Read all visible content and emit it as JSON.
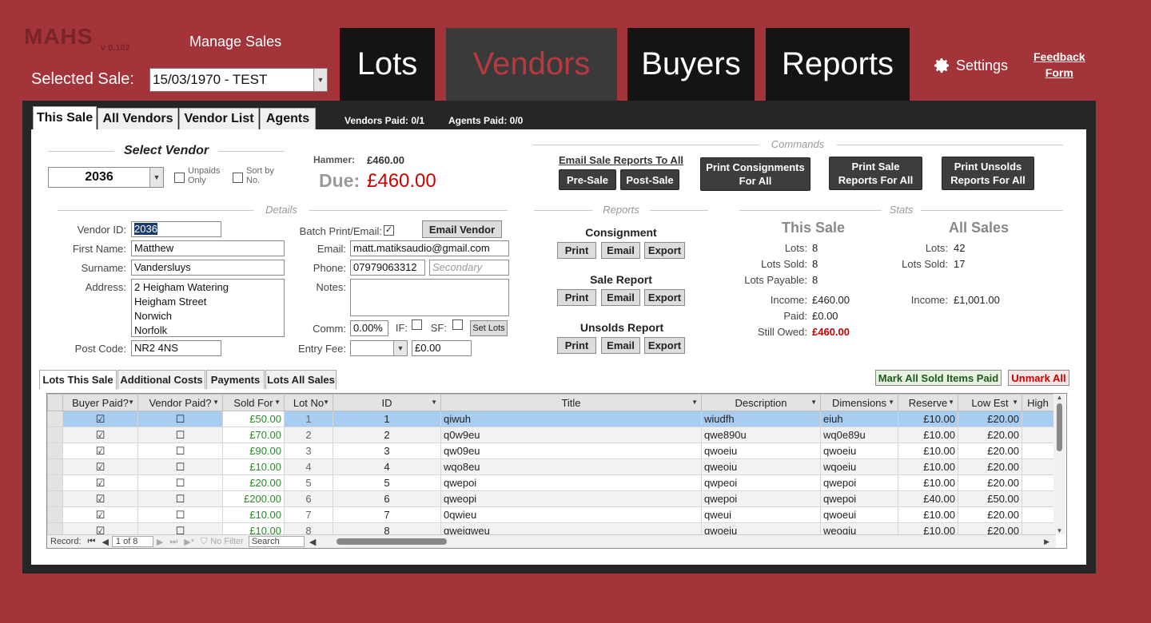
{
  "app": {
    "logo": "MAHS",
    "version": "v 0.102",
    "manage": "Manage Sales",
    "selected_sale_label": "Selected Sale:",
    "selected_sale": "15/03/1970 - TEST",
    "settings": "Settings",
    "feedback_line1": "Feedback",
    "feedback_line2": "Form"
  },
  "nav": {
    "lots": "Lots",
    "vendors": "Vendors",
    "buyers": "Buyers",
    "reports": "Reports"
  },
  "tabs": {
    "this_sale": "This Sale",
    "all_vendors": "All Vendors",
    "vendor_list": "Vendor List",
    "agents": "Agents",
    "vendors_paid": "Vendors Paid: 0/1",
    "agents_paid": "Agents Paid: 0/0"
  },
  "select": {
    "title": "Select Vendor",
    "vendor": "2036",
    "unpaids": "Unpaids Only",
    "sort": "Sort by No.",
    "hammer_label": "Hammer:",
    "hammer": "£460.00",
    "due_label": "Due:",
    "due": "£460.00"
  },
  "commands": {
    "title": "Commands",
    "email_reports": "Email Sale Reports To All",
    "pre_sale": "Pre-Sale",
    "post_sale": "Post-Sale",
    "print_consign": "Print Consignments For All",
    "print_sale": "Print Sale Reports For All",
    "print_unsolds": "Print Unsolds Reports For All"
  },
  "details": {
    "title": "Details",
    "vendor_id_label": "Vendor ID:",
    "vendor_id": "2036",
    "first_label": "First Name:",
    "first": "Matthew",
    "surname_label": "Surname:",
    "surname": "Vandersluys",
    "address_label": "Address:",
    "addr1": "2 Heigham Watering",
    "addr2": "Heigham Street",
    "addr3": "Norwich",
    "addr4": "Norfolk",
    "post_label": "Post Code:",
    "post": "NR2 4NS",
    "batch_label": "Batch Print/Email:",
    "email_vendor": "Email Vendor",
    "email_label": "Email:",
    "email": "matt.matiksaudio@gmail.com",
    "phone_label": "Phone:",
    "phone": "07979063312",
    "secondary": "Secondary",
    "notes_label": "Notes:",
    "comm_label": "Comm:",
    "comm": "0.00%",
    "if_label": "IF:",
    "sf_label": "SF:",
    "set_lots": "Set Lots",
    "entry_label": "Entry Fee:",
    "entry_fee": "£0.00"
  },
  "reports": {
    "title": "Reports",
    "consignment": "Consignment",
    "sale_report": "Sale Report",
    "unsolds": "Unsolds Report",
    "print": "Print",
    "email": "Email",
    "export": "Export"
  },
  "stats": {
    "title": "Stats",
    "this_sale": "This Sale",
    "all_sales": "All Sales",
    "lots_label": "Lots:",
    "lots_sold_label": "Lots Sold:",
    "lots_payable_label": "Lots Payable:",
    "income_label": "Income:",
    "paid_label": "Paid:",
    "owed_label": "Still Owed:",
    "ts_lots": "8",
    "ts_sold": "8",
    "ts_payable": "8",
    "ts_income": "£460.00",
    "ts_paid": "£0.00",
    "ts_owed": "£460.00",
    "as_lots": "42",
    "as_sold": "17",
    "as_income": "£1,001.00"
  },
  "subtabs": {
    "lots_this_sale": "Lots This Sale",
    "additional": "Additional Costs",
    "payments": "Payments",
    "lots_all": "Lots All Sales",
    "mark_all": "Mark All Sold Items Paid",
    "unmark_all": "Unmark All"
  },
  "grid": {
    "headers": [
      "Buyer Paid?",
      "Vendor Paid?",
      "Sold For",
      "Lot No",
      "ID",
      "Title",
      "Description",
      "Dimensions",
      "Reserve",
      "Low Est",
      "High"
    ],
    "rows": [
      {
        "buyer": "☑",
        "vendor": "☐",
        "sold": "£50.00",
        "lot": "1",
        "id": "1",
        "title": "qiwuh",
        "desc": "wiudfh",
        "dim": "eiuh",
        "reserve": "£10.00",
        "low": "£20.00"
      },
      {
        "buyer": "☑",
        "vendor": "☐",
        "sold": "£70.00",
        "lot": "2",
        "id": "2",
        "title": "q0w9eu",
        "desc": "qwe890u",
        "dim": "wq0e89u",
        "reserve": "£10.00",
        "low": "£20.00"
      },
      {
        "buyer": "☑",
        "vendor": "☐",
        "sold": "£90.00",
        "lot": "3",
        "id": "3",
        "title": "qw09eu",
        "desc": "qwoeiu",
        "dim": "qwoeiu",
        "reserve": "£10.00",
        "low": "£20.00"
      },
      {
        "buyer": "☑",
        "vendor": "☐",
        "sold": "£10.00",
        "lot": "4",
        "id": "4",
        "title": "wqo8eu",
        "desc": "qweoiu",
        "dim": "wqoeiu",
        "reserve": "£10.00",
        "low": "£20.00"
      },
      {
        "buyer": "☑",
        "vendor": "☐",
        "sold": "£20.00",
        "lot": "5",
        "id": "5",
        "title": "qwepoi",
        "desc": "qwpeoi",
        "dim": "qwepoi",
        "reserve": "£10.00",
        "low": "£20.00"
      },
      {
        "buyer": "☑",
        "vendor": "☐",
        "sold": "£200.00",
        "lot": "6",
        "id": "6",
        "title": "qweopi",
        "desc": "qwepoi",
        "dim": "qwepoi",
        "reserve": "£40.00",
        "low": "£50.00"
      },
      {
        "buyer": "☑",
        "vendor": "☐",
        "sold": "£10.00",
        "lot": "7",
        "id": "7",
        "title": "0qwieu",
        "desc": "qweui",
        "dim": "qwoeui",
        "reserve": "£10.00",
        "low": "£20.00"
      },
      {
        "buyer": "☑",
        "vendor": "☐",
        "sold": "£10.00",
        "lot": "8",
        "id": "8",
        "title": "qweiqweu",
        "desc": "qwoeiu",
        "dim": "weoqiu",
        "reserve": "£10.00",
        "low": "£20.00"
      }
    ]
  },
  "recnav": {
    "record": "Record:",
    "pos": "1 of 8",
    "nofilter": "No Filter",
    "search": "Search"
  },
  "colors": {
    "background": "#a3343a",
    "accent": "#b8393f",
    "owed": "#cc0000",
    "sold": "#2a8a2a"
  }
}
